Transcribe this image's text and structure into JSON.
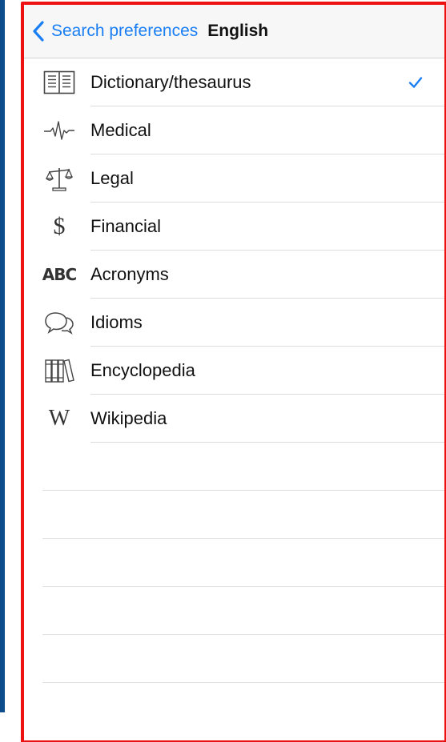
{
  "navbar": {
    "back_label": "Search preferences",
    "title": "English"
  },
  "colors": {
    "accent": "#1a7ef5",
    "highlight_border": "#ee1111",
    "side_strip": "#0e4d8c"
  },
  "options": [
    {
      "label": "Dictionary/thesaurus",
      "icon": "book-icon",
      "selected": true
    },
    {
      "label": "Medical",
      "icon": "heartbeat-icon",
      "selected": false
    },
    {
      "label": "Legal",
      "icon": "scales-icon",
      "selected": false
    },
    {
      "label": "Financial",
      "icon": "dollar-icon",
      "selected": false
    },
    {
      "label": "Acronyms",
      "icon": "abc-icon",
      "selected": false
    },
    {
      "label": "Idioms",
      "icon": "speech-bubbles-icon",
      "selected": false
    },
    {
      "label": "Encyclopedia",
      "icon": "books-icon",
      "selected": false
    },
    {
      "label": "Wikipedia",
      "icon": "wikipedia-icon",
      "selected": false
    }
  ],
  "icon_glyphs": {
    "dollar": "$",
    "abc": "ABC",
    "wiki": "W"
  }
}
